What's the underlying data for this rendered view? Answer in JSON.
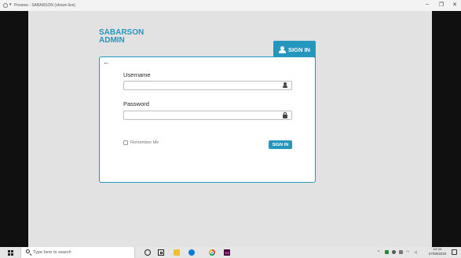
{
  "window": {
    "title": "Preview - SABARSON (shown live)",
    "controls": {
      "minimize": "–",
      "restore": "❐",
      "close": "✕"
    }
  },
  "app": {
    "brand_line1": "SABARSON",
    "brand_line2": "ADMIN",
    "tab_label": "SIGN IN"
  },
  "login": {
    "back_icon": "←",
    "username_label": "Username",
    "username_value": "",
    "password_label": "Password",
    "password_value": "",
    "remember_label": "Remember Me",
    "remember_checked": false,
    "submit_label": "SIGN IN",
    "accent_color": "#2596be"
  },
  "taskbar": {
    "search_placeholder": "Type here to search",
    "apps": [
      "cortana-icon",
      "task-view-icon",
      "file-explorer-icon",
      "edge-icon",
      "chrome-icon",
      "adobe-xd-icon"
    ],
    "xd_label": "Xd",
    "time": "12:11",
    "date": "27/06/2020"
  }
}
